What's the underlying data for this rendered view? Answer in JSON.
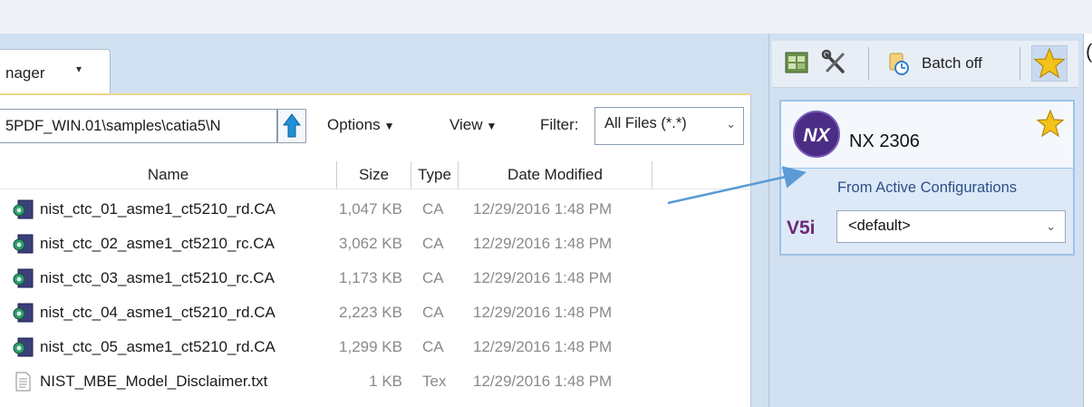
{
  "file_manager": {
    "tab_label": "nager",
    "path_value": "5PDF_WIN.01\\samples\\catia5\\N",
    "options_label": "Options",
    "view_label": "View",
    "filter_label": "Filter:",
    "filter_value": "All Files (*.*)",
    "columns": {
      "name": "Name",
      "size": "Size",
      "type": "Type",
      "date": "Date Modified"
    },
    "files": [
      {
        "name": "nist_ctc_01_asme1_ct5210_rd.CA",
        "size": "1,047 KB",
        "type": "CA",
        "date": "12/29/2016 1:48 PM",
        "icon": "catia-file-icon"
      },
      {
        "name": "nist_ctc_02_asme1_ct5210_rc.CA",
        "size": "3,062 KB",
        "type": "CA",
        "date": "12/29/2016 1:48 PM",
        "icon": "catia-file-icon"
      },
      {
        "name": "nist_ctc_03_asme1_ct5210_rc.CA",
        "size": "1,173 KB",
        "type": "CA",
        "date": "12/29/2016 1:48 PM",
        "icon": "catia-file-icon"
      },
      {
        "name": "nist_ctc_04_asme1_ct5210_rd.CA",
        "size": "2,223 KB",
        "type": "CA",
        "date": "12/29/2016 1:48 PM",
        "icon": "catia-file-icon"
      },
      {
        "name": "nist_ctc_05_asme1_ct5210_rd.CA",
        "size": "1,299 KB",
        "type": "CA",
        "date": "12/29/2016 1:48 PM",
        "icon": "catia-file-icon"
      },
      {
        "name": "NIST_MBE_Model_Disclaimer.txt",
        "size": "1 KB",
        "type": "Tex",
        "date": "12/29/2016 1:48 PM",
        "icon": "text-file-icon"
      }
    ]
  },
  "right_panel": {
    "batch_label": "Batch off",
    "card": {
      "title": "NX 2306",
      "logo_text": "NX",
      "subtitle": "From Active Configurations",
      "source_badge": "V5i",
      "config_value": "<default>"
    }
  },
  "colors": {
    "accent": "#1f8fd6",
    "star": "#f3c21b",
    "arrow": "#5b9bd5",
    "panel": "#d2e1f1"
  }
}
